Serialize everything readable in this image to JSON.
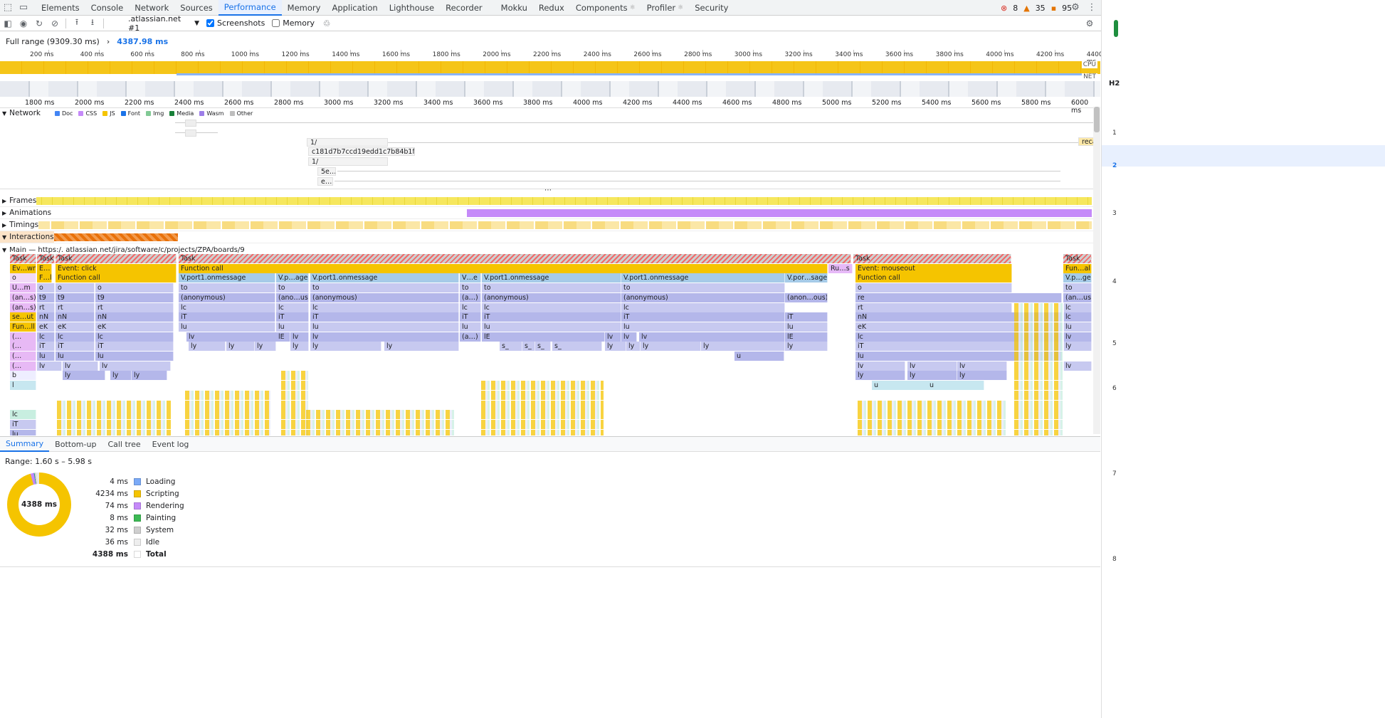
{
  "tabs": [
    "Elements",
    "Console",
    "Network",
    "Sources",
    "Performance",
    "Memory",
    "Application",
    "Lighthouse",
    "Recorder",
    "Mokku",
    "Redux",
    "Components",
    "Profiler",
    "Security"
  ],
  "active_tab": "Performance",
  "status": {
    "errors": "8",
    "warnings": "35",
    "issues": "95"
  },
  "toolbar": {
    "target": ".atlassian.net #1",
    "screenshots_label": "Screenshots",
    "memory_label": "Memory"
  },
  "range": {
    "full": "Full range (9309.30 ms)",
    "current": "4387.98 ms"
  },
  "overview_ticks": [
    "200 ms",
    "400 ms",
    "600 ms",
    "800 ms",
    "1000 ms",
    "1200 ms",
    "1400 ms",
    "1600 ms",
    "1800 ms",
    "2000 ms",
    "2200 ms",
    "2400 ms",
    "2600 ms",
    "2800 ms",
    "3000 ms",
    "3200 ms",
    "3400 ms",
    "3600 ms",
    "3800 ms",
    "4000 ms",
    "4200 ms",
    "4400 ms"
  ],
  "overview_labels": {
    "cpu": "CPU",
    "net": "NET"
  },
  "main_ticks": [
    "1800 ms",
    "2000 ms",
    "2200 ms",
    "2400 ms",
    "2600 ms",
    "2800 ms",
    "3000 ms",
    "3200 ms",
    "3400 ms",
    "3600 ms",
    "3800 ms",
    "4000 ms",
    "4200 ms",
    "4400 ms",
    "4600 ms",
    "4800 ms",
    "5000 ms",
    "5200 ms",
    "5400 ms",
    "5600 ms",
    "5800 ms",
    "6000 ms"
  ],
  "network": {
    "label": "Network",
    "legend": [
      {
        "name": "Doc",
        "color": "#4285f4"
      },
      {
        "name": "CSS",
        "color": "#c58af9"
      },
      {
        "name": "JS",
        "color": "#f5c400"
      },
      {
        "name": "Font",
        "color": "#1a73e8"
      },
      {
        "name": "Img",
        "color": "#81c995"
      },
      {
        "name": "Media",
        "color": "#188038"
      },
      {
        "name": "Wasm",
        "color": "#9d7ee8"
      },
      {
        "name": "Other",
        "color": "#bdbdbd"
      }
    ],
    "requests": [
      "1/",
      "c181d7b7ccd19edd1c7b84b1fa61…",
      "1/",
      "5e…",
      "e…",
      "reca"
    ]
  },
  "tracks": {
    "frames": "Frames",
    "animations": "Animations",
    "timings": "Timings",
    "interactions": "Interactions",
    "main": "Main — https:/.          atlassian.net/jira/software/c/projects/ZPA/boards/9"
  },
  "flame": {
    "task_label": "Task",
    "row1": [
      "Ev…wn",
      "E…",
      "Event: click",
      "Function call",
      "Ru…s",
      "Event: mouseout",
      "Fun…all"
    ],
    "row2": [
      "o",
      "F…l",
      "Function call",
      "V.port1.onmessage",
      "V.p…age",
      "V.port1.onmessage",
      "V…e",
      "V.port1.onmessage",
      "V.port1.onmessage",
      "V.por…sage",
      "Function call",
      "V.p…ge"
    ],
    "row3": [
      "U…m",
      "o",
      "o",
      "o",
      "to",
      "to",
      "to",
      "to",
      "to",
      "to",
      "o",
      "to"
    ],
    "row4": [
      "(an…s)",
      "t9",
      "t9",
      "t9",
      "(anonymous)",
      "(ano…us)",
      "(anonymous)",
      "(a…)",
      "(anonymous)",
      "(anonymous)",
      "(anon…ous)",
      "re",
      "(an…us)"
    ],
    "row5": [
      "(an…s)",
      "rt",
      "rt",
      "rt",
      "lc",
      "lc",
      "lc",
      "lc",
      "lc",
      "lc",
      "rt",
      "lc"
    ],
    "row6": [
      "se…ut",
      "nN",
      "nN",
      "nN",
      "iT",
      "iT",
      "iT",
      "iT",
      "iT",
      "iT",
      "iT",
      "nN",
      "lc"
    ],
    "row7": [
      "Fun…ll",
      "eK",
      "eK",
      "eK",
      "lu",
      "lu",
      "lu",
      "lu",
      "lu",
      "lu",
      "lu",
      "eK",
      "lu"
    ],
    "row8": [
      "(…",
      "lc",
      "lc",
      "lc",
      "lv",
      "lE",
      "lv",
      "lv",
      "(a…)",
      "lE",
      "lv",
      "lv",
      "lv",
      "lE",
      "lc",
      "lv"
    ],
    "row9": [
      "(…",
      "iT",
      "iT",
      "iT",
      "ly",
      "ly",
      "ly",
      "ly",
      "ly",
      "ly",
      "s_",
      "s_",
      "s_",
      "s_",
      "ly",
      "ly",
      "ly",
      "ly",
      "ly",
      "iT",
      "ly"
    ],
    "row10": [
      "(…",
      "lu",
      "lu",
      "lu",
      "u",
      "lu"
    ],
    "row11": [
      "(…",
      "lv",
      "lv",
      "lv",
      "lv",
      "lv",
      "lv",
      "lv"
    ],
    "row12": [
      "b",
      "ly",
      "ly",
      "ly",
      "ly",
      "ly",
      "ly",
      "ly"
    ],
    "row13": [
      "l",
      "u",
      "u"
    ],
    "row14": [
      "lc"
    ],
    "row15": [
      "iT"
    ],
    "row16": [
      "lu"
    ]
  },
  "bottom_tabs": [
    "Summary",
    "Bottom-up",
    "Call tree",
    "Event log"
  ],
  "summary": {
    "range": "Range: 1.60 s – 5.98 s",
    "total_center": "4388 ms",
    "rows": [
      {
        "value": "4 ms",
        "label": "Loading",
        "color": "#7baaf7"
      },
      {
        "value": "4234 ms",
        "label": "Scripting",
        "color": "#f5c400"
      },
      {
        "value": "74 ms",
        "label": "Rendering",
        "color": "#c58af9"
      },
      {
        "value": "8 ms",
        "label": "Painting",
        "color": "#3cba54"
      },
      {
        "value": "32 ms",
        "label": "System",
        "color": "#cfcfcf"
      },
      {
        "value": "36 ms",
        "label": "Idle",
        "color": "#eeeeee"
      },
      {
        "value": "4388 ms",
        "label": "Total",
        "color": "#ffffff"
      }
    ]
  },
  "right_panel": {
    "header": "H2",
    "numbers": [
      "1",
      "2",
      "3",
      "4",
      "5",
      "6",
      "7",
      "8"
    ]
  }
}
